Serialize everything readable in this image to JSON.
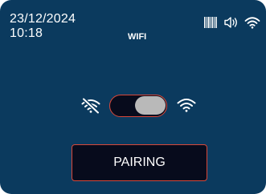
{
  "status_bar": {
    "date": "23/12/2024",
    "time": "10:18",
    "screen_title": "WIFI",
    "icons": [
      "barcode-icon",
      "speaker-icon",
      "wifi-icon"
    ]
  },
  "wifi_toggle": {
    "left_icon": "wifi-off-icon",
    "right_icon": "wifi-on-icon",
    "state": "on"
  },
  "pairing": {
    "label": "PAIRING"
  },
  "colors": {
    "background": "#0b3a5e",
    "control_fill": "#070b1c",
    "accent_border": "#d8483a",
    "knob": "#b9b9b9",
    "text": "#ffffff"
  }
}
